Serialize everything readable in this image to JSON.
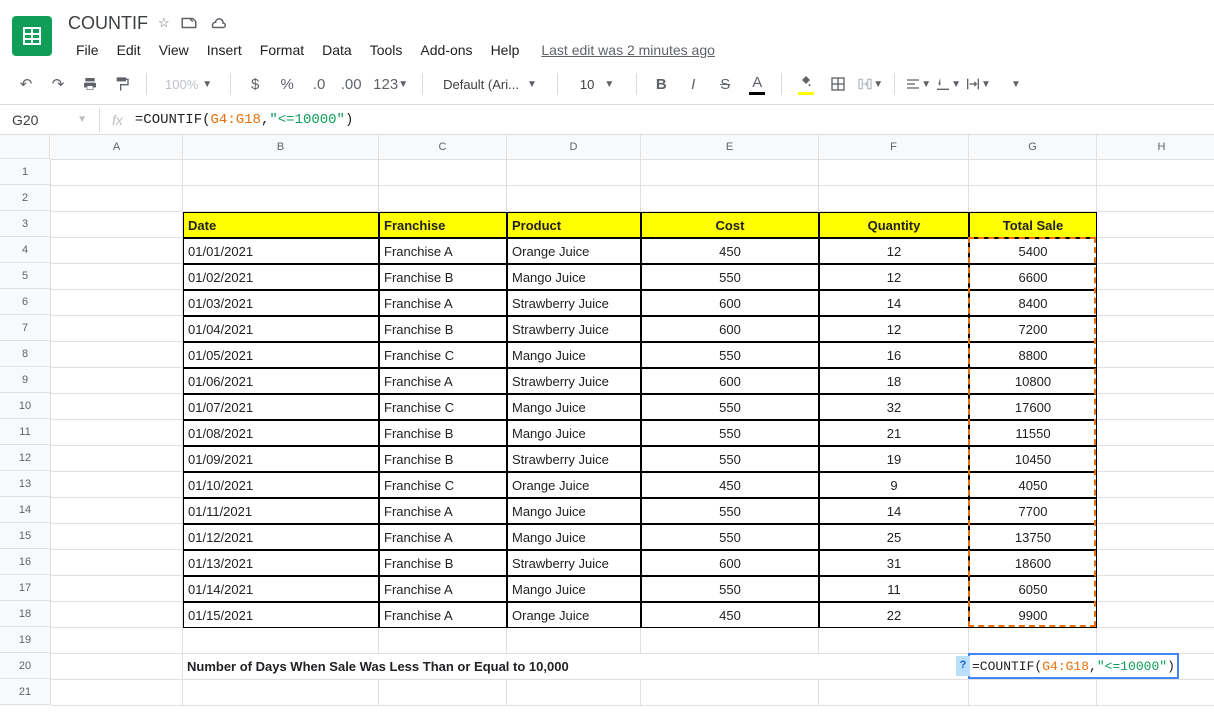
{
  "doc_title": "COUNTIF",
  "menu": {
    "file": "File",
    "edit": "Edit",
    "view": "View",
    "insert": "Insert",
    "format": "Format",
    "data": "Data",
    "tools": "Tools",
    "addons": "Add-ons",
    "help": "Help"
  },
  "last_edit": "Last edit was 2 minutes ago",
  "toolbar": {
    "zoom": "100%",
    "font": "Default (Ari...",
    "font_size": "10"
  },
  "name_box": "G20",
  "formula": {
    "prefix": "=COUNTIF(",
    "range": "G4:G18",
    "comma": ",",
    "criterion": "\"<=10000\"",
    "suffix": ")"
  },
  "columns": [
    "A",
    "B",
    "C",
    "D",
    "E",
    "F",
    "G",
    "H"
  ],
  "row_count": 21,
  "headers": {
    "date": "Date",
    "franchise": "Franchise",
    "product": "Product",
    "cost": "Cost",
    "quantity": "Quantity",
    "total_sale": "Total Sale"
  },
  "rows": [
    {
      "date": "01/01/2021",
      "franchise": "Franchise A",
      "product": "Orange Juice",
      "cost": "450",
      "qty": "12",
      "total": "5400"
    },
    {
      "date": "01/02/2021",
      "franchise": "Franchise B",
      "product": "Mango Juice",
      "cost": "550",
      "qty": "12",
      "total": "6600"
    },
    {
      "date": "01/03/2021",
      "franchise": "Franchise A",
      "product": "Strawberry Juice",
      "cost": "600",
      "qty": "14",
      "total": "8400"
    },
    {
      "date": "01/04/2021",
      "franchise": "Franchise B",
      "product": "Strawberry Juice",
      "cost": "600",
      "qty": "12",
      "total": "7200"
    },
    {
      "date": "01/05/2021",
      "franchise": "Franchise C",
      "product": "Mango Juice",
      "cost": "550",
      "qty": "16",
      "total": "8800"
    },
    {
      "date": "01/06/2021",
      "franchise": "Franchise A",
      "product": "Strawberry Juice",
      "cost": "600",
      "qty": "18",
      "total": "10800"
    },
    {
      "date": "01/07/2021",
      "franchise": "Franchise C",
      "product": "Mango Juice",
      "cost": "550",
      "qty": "32",
      "total": "17600"
    },
    {
      "date": "01/08/2021",
      "franchise": "Franchise B",
      "product": "Mango Juice",
      "cost": "550",
      "qty": "21",
      "total": "11550"
    },
    {
      "date": "01/09/2021",
      "franchise": "Franchise B",
      "product": "Strawberry Juice",
      "cost": "550",
      "qty": "19",
      "total": "10450"
    },
    {
      "date": "01/10/2021",
      "franchise": "Franchise C",
      "product": "Orange Juice",
      "cost": "450",
      "qty": "9",
      "total": "4050"
    },
    {
      "date": "01/11/2021",
      "franchise": "Franchise A",
      "product": "Mango Juice",
      "cost": "550",
      "qty": "14",
      "total": "7700"
    },
    {
      "date": "01/12/2021",
      "franchise": "Franchise A",
      "product": "Mango Juice",
      "cost": "550",
      "qty": "25",
      "total": "13750"
    },
    {
      "date": "01/13/2021",
      "franchise": "Franchise B",
      "product": "Strawberry Juice",
      "cost": "600",
      "qty": "31",
      "total": "18600"
    },
    {
      "date": "01/14/2021",
      "franchise": "Franchise A",
      "product": "Mango Juice",
      "cost": "550",
      "qty": "11",
      "total": "6050"
    },
    {
      "date": "01/15/2021",
      "franchise": "Franchise A",
      "product": "Orange Juice",
      "cost": "450",
      "qty": "22",
      "total": "9900"
    }
  ],
  "summary_label": "Number of Days When Sale Was Less Than or Equal to 10,000"
}
